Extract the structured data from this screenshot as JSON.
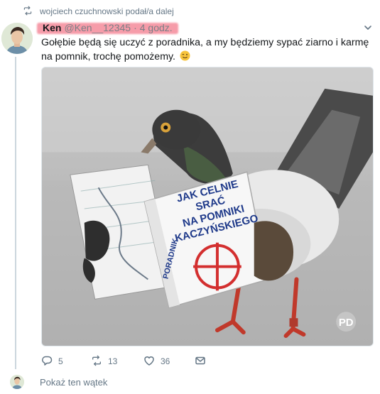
{
  "retweet": {
    "text": "wojciech czuchnowski podał/a dalej",
    "icon": "retweet-icon"
  },
  "tweet": {
    "display_name": "Ken",
    "handle": "@Ken__12345",
    "separator": "·",
    "time": "4 godz.",
    "text": "Gołębie będą się uczyć z poradnika, a my będziemy sypać ziarno i karmę na pomnik, trochę pomożemy.",
    "emoji": "winking-face-emoji",
    "highlight_color": "#f47b8d"
  },
  "media": {
    "book_title": "JAK CELNIE SRAĆ NA POMNIKI KACZYŃSKIEGO",
    "book_title_lines": [
      "JAK CELNIE",
      "SRAĆ",
      "NA POMNIKI",
      "KACZYŃSKIEGO"
    ],
    "book_spine": "PORADNIK",
    "watermark": "PD",
    "crosshair_color": "#d32f2f"
  },
  "actions": {
    "reply_count": "5",
    "retweet_count": "13",
    "like_count": "36"
  },
  "show_thread": {
    "label": "Pokaż ten wątek"
  }
}
